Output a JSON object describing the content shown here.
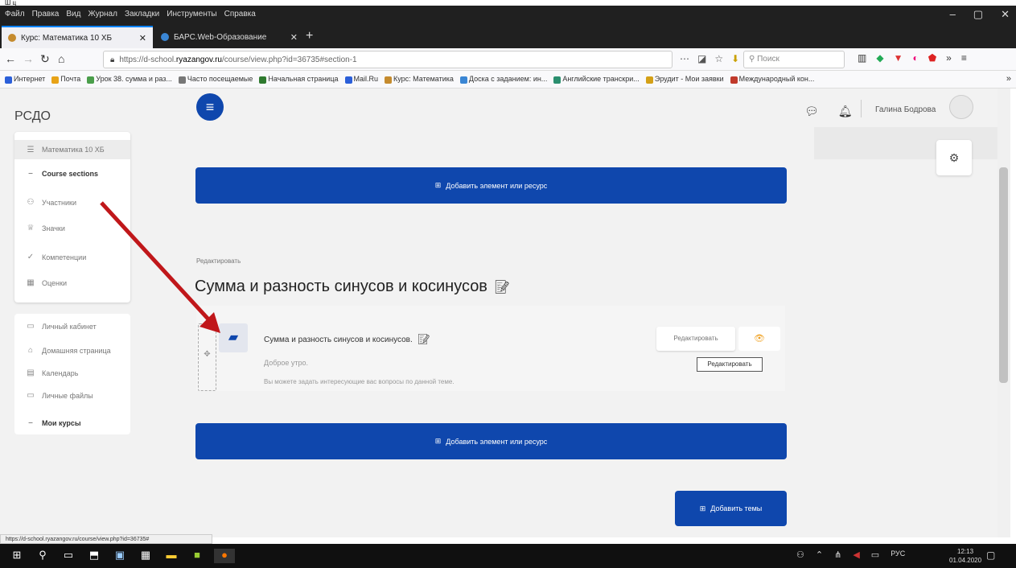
{
  "top_fragment": "Ш ц",
  "menubar": {
    "items": [
      "Файл",
      "Правка",
      "Вид",
      "Журнал",
      "Закладки",
      "Инструменты",
      "Справка"
    ],
    "window_controls": [
      "–",
      "▢",
      "✕"
    ]
  },
  "tabs": [
    {
      "title": "Курс: Математика 10 ХБ",
      "active": true,
      "icon_color": "#c58b2e"
    },
    {
      "title": "БАРС.Web-Образование",
      "active": false,
      "icon_color": "#3a86d4"
    }
  ],
  "navbar": {
    "url_prefix": "https://d-school.",
    "url_domain": "ryazangov.ru",
    "url_rest": "/course/view.php?id=36735#section-1",
    "search_placeholder": "Поиск"
  },
  "bookmarks": [
    {
      "label": "Интернет",
      "color": "#2b5fd9"
    },
    {
      "label": "Почта",
      "color": "#e8a317"
    },
    {
      "label": "Урок 38. сумма и раз...",
      "color": "#4a9e4a"
    },
    {
      "label": "Часто посещаемые",
      "color": "#777777"
    },
    {
      "label": "Начальная страница",
      "color": "#2f7a2f"
    },
    {
      "label": "Mail.Ru",
      "color": "#2b5fd9"
    },
    {
      "label": "Курс: Математика",
      "color": "#c58b2e"
    },
    {
      "label": "Доска с заданием: ин...",
      "color": "#3a86d4"
    },
    {
      "label": "Английские транскри...",
      "color": "#2b8f6f"
    },
    {
      "label": "Эрудит - Мои заявки",
      "color": "#d4a017"
    },
    {
      "label": "Международный кон...",
      "color": "#c0392b"
    }
  ],
  "header": {
    "brand": "РСДО",
    "user_name": "Галина Бодрова"
  },
  "sidebar": {
    "course_items": [
      {
        "label": "Математика 10 ХБ",
        "icon": "☰"
      },
      {
        "label": "Course sections",
        "icon": "–"
      },
      {
        "label": "Участники",
        "icon": "⚇"
      },
      {
        "label": "Значки",
        "icon": "♕"
      },
      {
        "label": "Компетенции",
        "icon": "✓"
      },
      {
        "label": "Оценки",
        "icon": "▦"
      }
    ],
    "main_items": [
      {
        "label": "Личный кабинет",
        "icon": "▭"
      },
      {
        "label": "Домашняя страница",
        "icon": "⌂"
      },
      {
        "label": "Календарь",
        "icon": "▤"
      },
      {
        "label": "Личные файлы",
        "icon": "▭"
      },
      {
        "label": "Мои курсы",
        "icon": "–"
      }
    ]
  },
  "main": {
    "add_button_label": "Добавить элемент или ресурс",
    "edit_label": "Редактировать",
    "section_title": "Сумма и разность синусов и косинусов",
    "activity": {
      "title": "Сумма и разность синусов и косинусов.",
      "desc1": "Доброе утро.",
      "desc2": "Вы можете задать интересующие вас вопросы по данной теме.",
      "edit_button": "Редактировать",
      "tooltip": "Редактировать"
    },
    "add_topic_label": "Добавить темы"
  },
  "status_url": "https://d-school.ryazangov.ru/course/view.php?id=36735#",
  "taskbar": {
    "tray_lang": "РУС",
    "clock_time": "12:13",
    "clock_date": "01.04.2020"
  },
  "colors": {
    "accent": "#0f47ad",
    "arrow": "#c0171a"
  }
}
